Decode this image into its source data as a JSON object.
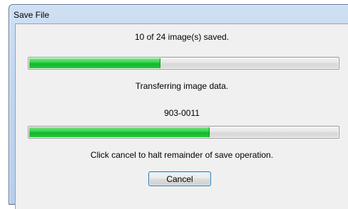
{
  "window": {
    "title": "Save File"
  },
  "dialog": {
    "count_status": "10 of 24 image(s) saved.",
    "overall_progress": {
      "fraction": 0.42
    },
    "transfer_status": "Transferring image data.",
    "current_item": "903-0011",
    "item_progress": {
      "fraction": 0.58
    },
    "instruction": "Click cancel to halt remainder of save operation.",
    "cancel_label": "Cancel"
  },
  "colors": {
    "progress_green": "#13b82a",
    "title_bar": "#c2d6ee",
    "button_border": "#3c7fb1"
  }
}
